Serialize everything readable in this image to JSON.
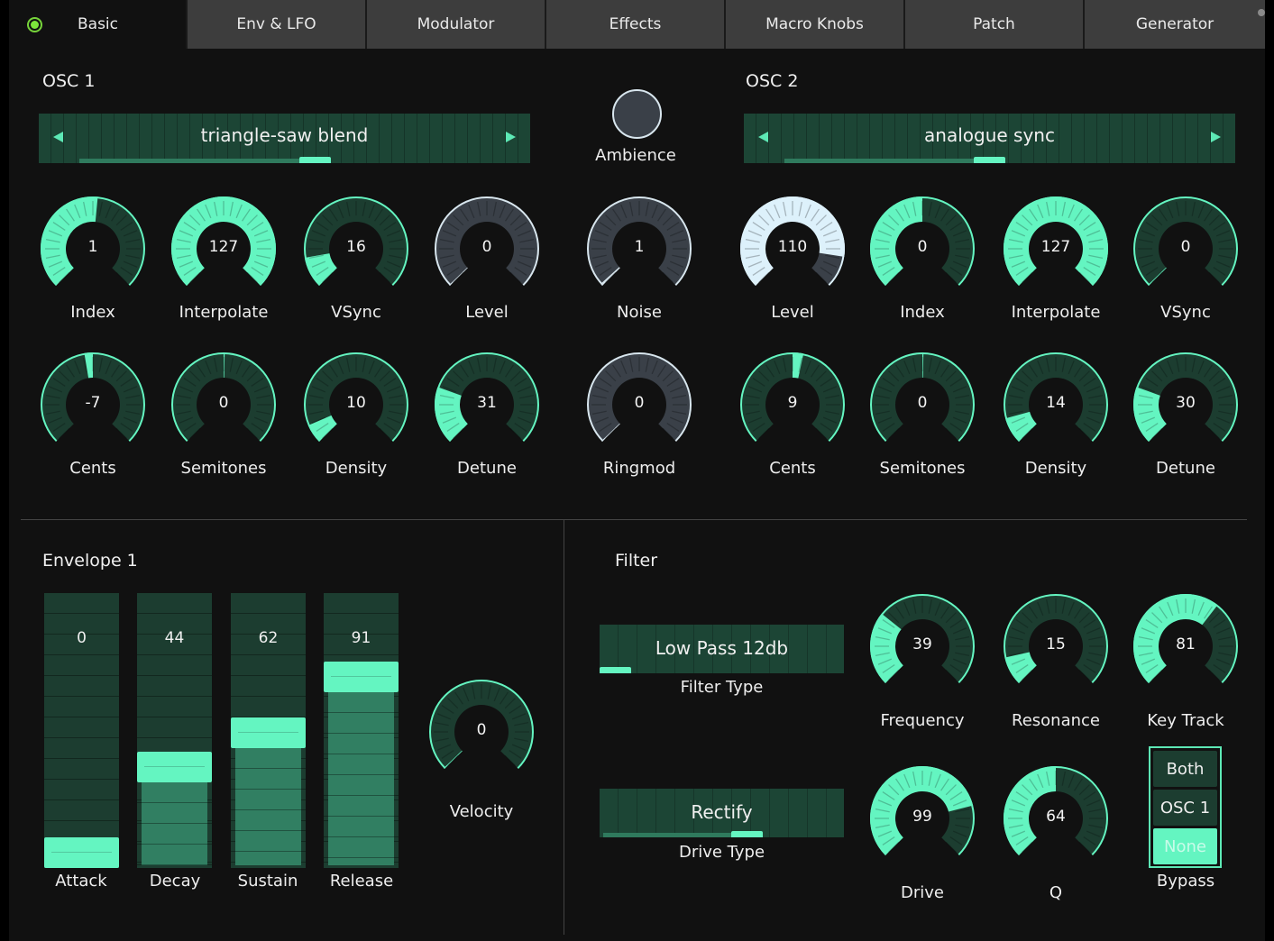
{
  "tabs": [
    {
      "label": "Basic",
      "active": true
    },
    {
      "label": "Env & LFO"
    },
    {
      "label": "Modulator"
    },
    {
      "label": "Effects"
    },
    {
      "label": "Macro Knobs"
    },
    {
      "label": "Patch"
    },
    {
      "label": "Generator"
    }
  ],
  "colors": {
    "accent": "#64f5c1",
    "accent_dark": "#1c3d30",
    "gray_fill": "#3a4048",
    "gray_ring": "#d8e6ee",
    "light_fill": "#ddf1fb",
    "background": "#111111",
    "power_led": "#7ce63b"
  },
  "osc1": {
    "title": "OSC  1",
    "waveform": {
      "value": "triangle-saw blend",
      "position": 0.58
    },
    "knobs_row1": [
      {
        "label": "Index",
        "value": "1",
        "fraction": 0.52,
        "theme": "green"
      },
      {
        "label": "Interpolate",
        "value": "127",
        "fraction": 1.0,
        "theme": "green"
      },
      {
        "label": "VSync",
        "value": "16",
        "fraction": 0.13,
        "theme": "green"
      },
      {
        "label": "Level",
        "value": "0",
        "fraction": 0.0,
        "theme": "gray"
      }
    ],
    "knobs_row2": [
      {
        "label": "Cents",
        "value": "-7",
        "fraction": -0.07,
        "theme": "green",
        "bipolar": true
      },
      {
        "label": "Semitones",
        "value": "0",
        "fraction": 0.0,
        "theme": "green",
        "bipolar": true
      },
      {
        "label": "Density",
        "value": "10",
        "fraction": 0.08,
        "theme": "green"
      },
      {
        "label": "Detune",
        "value": "31",
        "fraction": 0.24,
        "theme": "green"
      }
    ]
  },
  "center": {
    "ambience_label": "Ambience",
    "noise": {
      "label": "Noise",
      "value": "1",
      "fraction": 0.01,
      "theme": "gray"
    },
    "ringmod": {
      "label": "Ringmod",
      "value": "0",
      "fraction": 0.0,
      "theme": "gray"
    }
  },
  "osc2": {
    "title": "OSC 2",
    "waveform": {
      "value": "analogue sync",
      "position": 0.5
    },
    "knobs_row1": [
      {
        "label": "Level",
        "value": "110",
        "fraction": 0.866,
        "theme": "light"
      },
      {
        "label": "Index",
        "value": "0",
        "fraction": 0.5,
        "theme": "green"
      },
      {
        "label": "Interpolate",
        "value": "127",
        "fraction": 1.0,
        "theme": "green"
      },
      {
        "label": "VSync",
        "value": "0",
        "fraction": 0.0,
        "theme": "green"
      }
    ],
    "knobs_row2": [
      {
        "label": "Cents",
        "value": "9",
        "fraction": 0.09,
        "theme": "green",
        "bipolar": true
      },
      {
        "label": "Semitones",
        "value": "0",
        "fraction": 0.0,
        "theme": "green",
        "bipolar": true
      },
      {
        "label": "Density",
        "value": "14",
        "fraction": 0.11,
        "theme": "green"
      },
      {
        "label": "Detune",
        "value": "30",
        "fraction": 0.24,
        "theme": "green"
      }
    ]
  },
  "envelope": {
    "title": "Envelope 1",
    "sliders": [
      {
        "label": "Attack",
        "value": "0",
        "fraction": 0.0
      },
      {
        "label": "Decay",
        "value": "44",
        "fraction": 0.35
      },
      {
        "label": "Sustain",
        "value": "62",
        "fraction": 0.49
      },
      {
        "label": "Release",
        "value": "91",
        "fraction": 0.72
      }
    ],
    "velocity": {
      "label": "Velocity",
      "value": "0",
      "fraction": 0.0,
      "theme": "green"
    }
  },
  "filter": {
    "title": "Filter",
    "filter_type": {
      "label": "Filter Type",
      "value": "Low Pass 12db",
      "position": 0.0
    },
    "drive_type": {
      "label": "Drive Type",
      "value": "Rectify",
      "position": 0.62
    },
    "knobs_row1": [
      {
        "label": "Frequency",
        "value": "39",
        "fraction": 0.31,
        "theme": "green"
      },
      {
        "label": "Resonance",
        "value": "15",
        "fraction": 0.12,
        "theme": "green"
      },
      {
        "label": "Key Track",
        "value": "81",
        "fraction": 0.64,
        "theme": "green"
      }
    ],
    "knobs_row2": [
      {
        "label": "Drive",
        "value": "99",
        "fraction": 0.78,
        "theme": "green"
      },
      {
        "label": "Q",
        "value": "64",
        "fraction": 0.5,
        "theme": "green"
      }
    ],
    "bypass": {
      "label": "Bypass",
      "options": [
        "Both",
        "OSC 1",
        "None"
      ],
      "selected": "None"
    }
  }
}
